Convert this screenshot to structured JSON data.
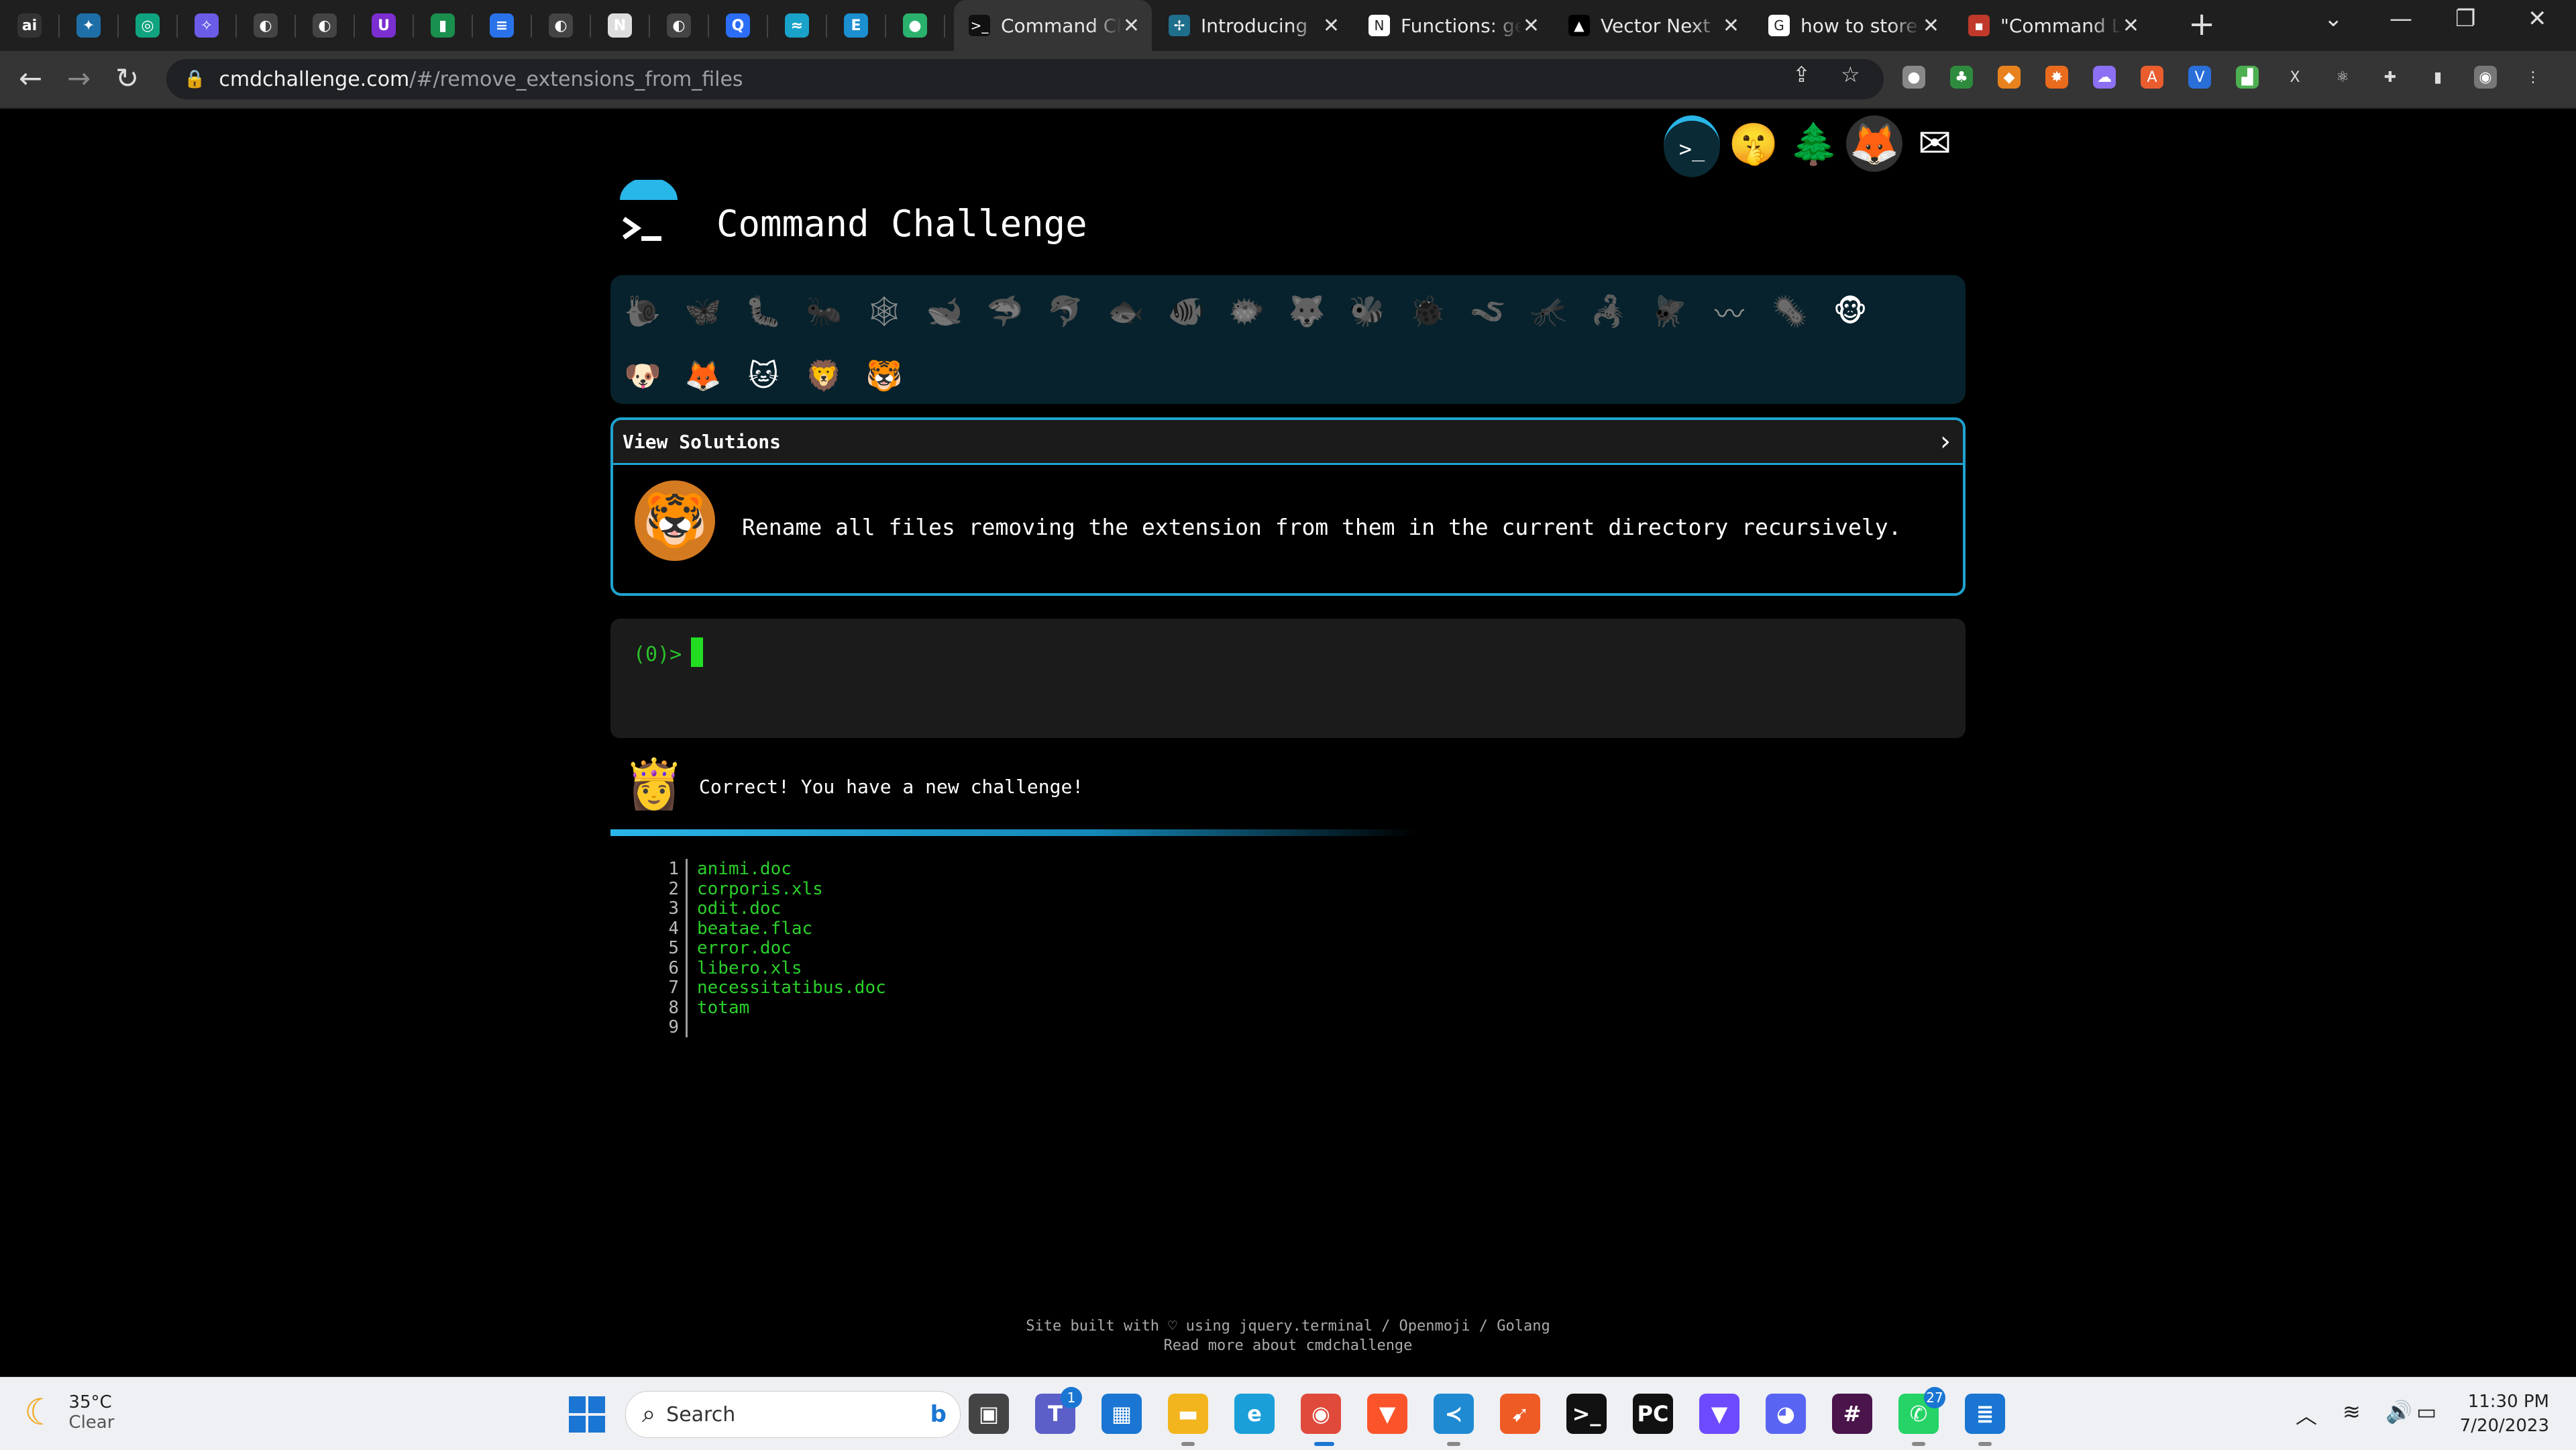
{
  "browser": {
    "pinned_tabs": [
      {
        "icon": "ai-icon",
        "glyph": "ai",
        "color": "#333"
      },
      {
        "icon": "perplexity-icon",
        "glyph": "✦",
        "color": "#1e6fa8"
      },
      {
        "icon": "chatgpt-icon",
        "glyph": "◎",
        "color": "#10a37f"
      },
      {
        "icon": "sparkle-icon",
        "glyph": "✧",
        "color": "#6b5ce7"
      },
      {
        "icon": "github-icon",
        "glyph": "◐",
        "color": "#444"
      },
      {
        "icon": "github-icon",
        "glyph": "◐",
        "color": "#444"
      },
      {
        "icon": "uplift-icon",
        "glyph": "U",
        "color": "#7b2fd1"
      },
      {
        "icon": "evernote-icon",
        "glyph": "▮",
        "color": "#1a8f4e"
      },
      {
        "icon": "google-docs-icon",
        "glyph": "≡",
        "color": "#2a72ea"
      },
      {
        "icon": "github-icon",
        "glyph": "◐",
        "color": "#444"
      },
      {
        "icon": "notion-icon",
        "glyph": "N",
        "color": "#ddd"
      },
      {
        "icon": "github-icon",
        "glyph": "◐",
        "color": "#444"
      },
      {
        "icon": "perplexity-icon",
        "glyph": "Q",
        "color": "#2b6ef5"
      },
      {
        "icon": "tailwind-icon",
        "glyph": "≈",
        "color": "#1aa3c9"
      },
      {
        "icon": "e-icon",
        "glyph": "E",
        "color": "#1b8fd0"
      },
      {
        "icon": "leaf-icon",
        "glyph": "●",
        "color": "#2ab26d"
      }
    ],
    "tabs": [
      {
        "title": "Command Ch",
        "icon": "terminal-icon",
        "glyph": ">_",
        "color": "#111",
        "active": true
      },
      {
        "title": "Introducing",
        "icon": "star-icon",
        "glyph": "✢",
        "color": "#1f6e8c",
        "active": false
      },
      {
        "title": "Functions: ge",
        "icon": "notion-icon",
        "glyph": "N",
        "color": "#fff",
        "active": false
      },
      {
        "title": "Vector Next",
        "icon": "vercel-icon",
        "glyph": "▲",
        "color": "#000",
        "active": false
      },
      {
        "title": "how to store",
        "icon": "google-icon",
        "glyph": "G",
        "color": "#fff",
        "active": false
      },
      {
        "title": "\"Command L",
        "icon": "flag-icon",
        "glyph": "▪",
        "color": "#c0392b",
        "active": false
      }
    ],
    "new_tab": "+",
    "window_controls": [
      "⌄",
      "—",
      "❐",
      "✕"
    ],
    "url_domain": "cmdchallenge.com",
    "url_path": "/#/remove_extensions_from_files",
    "extensions": [
      {
        "name": "mouse-icon",
        "glyph": "●",
        "color": "#888"
      },
      {
        "name": "tree-icon",
        "glyph": "♣",
        "color": "#2e8b3d"
      },
      {
        "name": "metamask-icon",
        "glyph": "◆",
        "color": "#e8821e"
      },
      {
        "name": "burst-icon",
        "glyph": "✸",
        "color": "#e86b1e"
      },
      {
        "name": "cloud-icon",
        "glyph": "☁",
        "color": "#8c6ff2"
      },
      {
        "name": "a-icon",
        "glyph": "A",
        "color": "#e95d2e"
      },
      {
        "name": "v-icon",
        "glyph": "V",
        "color": "#2a6ed8"
      },
      {
        "name": "mole-icon",
        "glyph": "▟",
        "color": "#4caf50"
      },
      {
        "name": "x-icon",
        "glyph": "X",
        "color": "#444"
      },
      {
        "name": "react-icon",
        "glyph": "⚛",
        "color": "#444"
      },
      {
        "name": "puzzle-icon",
        "glyph": "✚",
        "color": "#444"
      },
      {
        "name": "sidepanel-icon",
        "glyph": "▮",
        "color": "#444"
      },
      {
        "name": "profile-avatar-icon",
        "glyph": "◉",
        "color": "#777"
      },
      {
        "name": "menu-icon",
        "glyph": "⋮",
        "color": "#444"
      }
    ]
  },
  "page": {
    "top_nav": [
      {
        "name": "terminal-icon",
        "glyph": ">_",
        "bg": "#0a2a35"
      },
      {
        "name": "shushing-face-icon",
        "glyph": "🤫",
        "bg": "transparent"
      },
      {
        "name": "evergreen-tree-icon",
        "glyph": "🌲",
        "bg": "transparent"
      },
      {
        "name": "gitlab-icon",
        "glyph": "🦊",
        "bg": "#333"
      },
      {
        "name": "envelope-icon",
        "glyph": "✉",
        "bg": "transparent"
      }
    ],
    "logo_glyph": ">_",
    "title": "Command Challenge",
    "badges": [
      {
        "name": "snail-icon",
        "glyph": "🐌",
        "active": false
      },
      {
        "name": "butterfly-icon",
        "glyph": "🦋",
        "active": false
      },
      {
        "name": "caterpillar-icon",
        "glyph": "🐛",
        "active": false
      },
      {
        "name": "ant-icon",
        "glyph": "🐜",
        "active": false
      },
      {
        "name": "spider-web-icon",
        "glyph": "🕸",
        "active": false
      },
      {
        "name": "whale-icon",
        "glyph": "🐋",
        "active": false
      },
      {
        "name": "shark-icon",
        "glyph": "🦈",
        "active": false
      },
      {
        "name": "dolphin-icon",
        "glyph": "🐬",
        "active": false
      },
      {
        "name": "fish-icon",
        "glyph": "🐟",
        "active": false
      },
      {
        "name": "tropical-fish-icon",
        "glyph": "🐠",
        "active": false
      },
      {
        "name": "blowfish-icon",
        "glyph": "🐡",
        "active": false
      },
      {
        "name": "wolf-icon",
        "glyph": "🐺",
        "active": false
      },
      {
        "name": "bee-icon",
        "glyph": "🐝",
        "active": false
      },
      {
        "name": "ladybug-icon",
        "glyph": "🐞",
        "active": false
      },
      {
        "name": "worm-icon",
        "glyph": "🪱",
        "active": false
      },
      {
        "name": "mosquito-icon",
        "glyph": "🦟",
        "active": false
      },
      {
        "name": "scorpion-icon",
        "glyph": "🦂",
        "active": false
      },
      {
        "name": "fly-icon",
        "glyph": "🪰",
        "active": false
      },
      {
        "name": "earthworm-icon",
        "glyph": "〰",
        "active": false
      },
      {
        "name": "microbe-icon",
        "glyph": "🦠",
        "active": false
      },
      {
        "name": "monkey-icon",
        "glyph": "🐵",
        "active": true
      },
      {
        "name": "dog-icon",
        "glyph": "🐶",
        "active": true
      },
      {
        "name": "fox-icon",
        "glyph": "🦊",
        "active": true
      },
      {
        "name": "cat-icon",
        "glyph": "🐱",
        "active": true
      },
      {
        "name": "lion-icon",
        "glyph": "🦁",
        "active": true
      },
      {
        "name": "tiger-icon",
        "glyph": "🐯",
        "active": true
      }
    ],
    "view_solutions": "View Solutions",
    "chevron": "›",
    "challenge_icon": "🐯",
    "challenge_text": "Rename all files removing the extension from them in the current directory recursively.",
    "prompt": "(0)>",
    "result_icon": "👸",
    "result_text": "Correct! You have a new challenge!",
    "files": [
      {
        "n": "1",
        "name": "animi.doc"
      },
      {
        "n": "2",
        "name": "corporis.xls"
      },
      {
        "n": "3",
        "name": "odit.doc"
      },
      {
        "n": "4",
        "name": "beatae.flac"
      },
      {
        "n": "5",
        "name": "error.doc"
      },
      {
        "n": "6",
        "name": "libero.xls"
      },
      {
        "n": "7",
        "name": "necessitatibus.doc"
      },
      {
        "n": "8",
        "name": "totam"
      },
      {
        "n": "9",
        "name": ""
      }
    ],
    "footer_line1": "Site built with ♡ using jquery.terminal / Openmoji / Golang",
    "footer_line2": "Read more about cmdchallenge"
  },
  "taskbar": {
    "temperature": "35°C",
    "condition": "Clear",
    "search_placeholder": "Search",
    "apps": [
      {
        "name": "task-view-icon",
        "glyph": "▣",
        "bg": "#444",
        "badge": "",
        "running": false
      },
      {
        "name": "teams-icon",
        "glyph": "T",
        "bg": "#5b5fc7",
        "badge": "1",
        "running": false
      },
      {
        "name": "microsoft-store-icon",
        "glyph": "▦",
        "bg": "#1a76d2",
        "badge": "",
        "running": false
      },
      {
        "name": "file-explorer-icon",
        "glyph": "▬",
        "bg": "#f2b51d",
        "badge": "",
        "running": true
      },
      {
        "name": "edge-icon",
        "glyph": "e",
        "bg": "#1b9fd8",
        "badge": "",
        "running": false
      },
      {
        "name": "chrome-icon",
        "glyph": "◉",
        "bg": "#e04a3b",
        "badge": "",
        "running": true
      },
      {
        "name": "brave-icon",
        "glyph": "▼",
        "bg": "#fb542b",
        "badge": "",
        "running": false
      },
      {
        "name": "vscode-icon",
        "glyph": "≺",
        "bg": "#1f8ad2",
        "badge": "",
        "running": true
      },
      {
        "name": "postman-icon",
        "glyph": "➹",
        "bg": "#ef5b25",
        "badge": "",
        "running": false
      },
      {
        "name": "terminal-icon",
        "glyph": ">_",
        "bg": "#111",
        "badge": "",
        "running": false
      },
      {
        "name": "pycharm-icon",
        "glyph": "PC",
        "bg": "#111",
        "badge": "",
        "running": false
      },
      {
        "name": "proton-vpn-icon",
        "glyph": "▼",
        "bg": "#6d4aff",
        "badge": "",
        "running": false
      },
      {
        "name": "discord-icon",
        "glyph": "◕",
        "bg": "#5865f2",
        "badge": "",
        "running": false
      },
      {
        "name": "slack-icon",
        "glyph": "#",
        "bg": "#4a154b",
        "badge": "",
        "running": false
      },
      {
        "name": "whatsapp-icon",
        "glyph": "✆",
        "bg": "#25d366",
        "badge": "27",
        "running": true
      },
      {
        "name": "notepad-icon",
        "glyph": "≣",
        "bg": "#1a76d2",
        "badge": "",
        "running": true
      }
    ],
    "tray": [
      {
        "name": "chevron-up-icon",
        "glyph": "︿"
      },
      {
        "name": "wifi-icon",
        "glyph": "≋"
      },
      {
        "name": "volume-icon",
        "glyph": "🔊"
      },
      {
        "name": "battery-icon",
        "glyph": "▭"
      }
    ],
    "time": "11:30 PM",
    "date": "7/20/2023"
  }
}
